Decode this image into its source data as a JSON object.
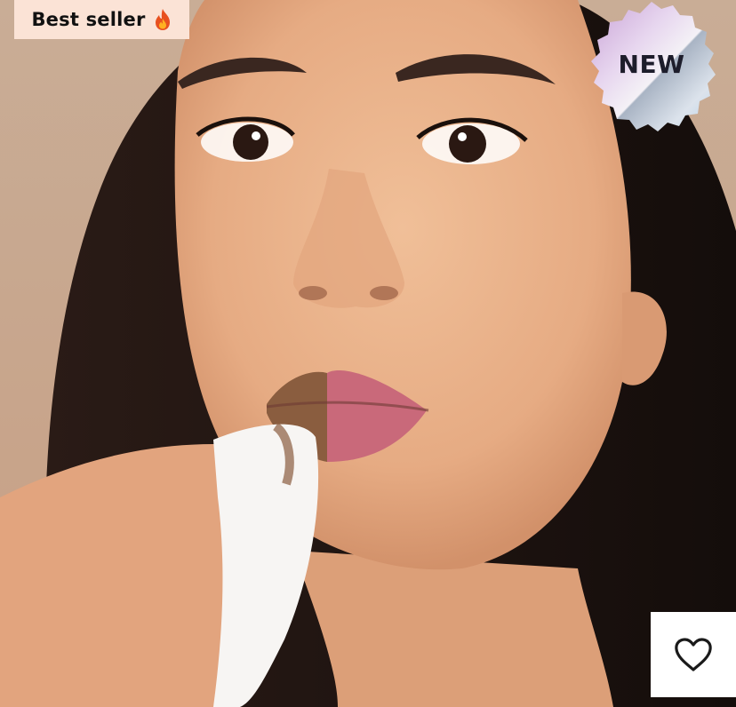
{
  "badges": {
    "best_seller": {
      "label": "Best seller",
      "icon": "fire-icon",
      "background": "#fbe3d6"
    },
    "new": {
      "label": "NEW",
      "style": "holographic-scalloped-seal"
    }
  },
  "wishlist": {
    "icon": "heart-outline-icon",
    "background": "#ffffff"
  },
  "photo": {
    "subject": "product-model-photo"
  }
}
